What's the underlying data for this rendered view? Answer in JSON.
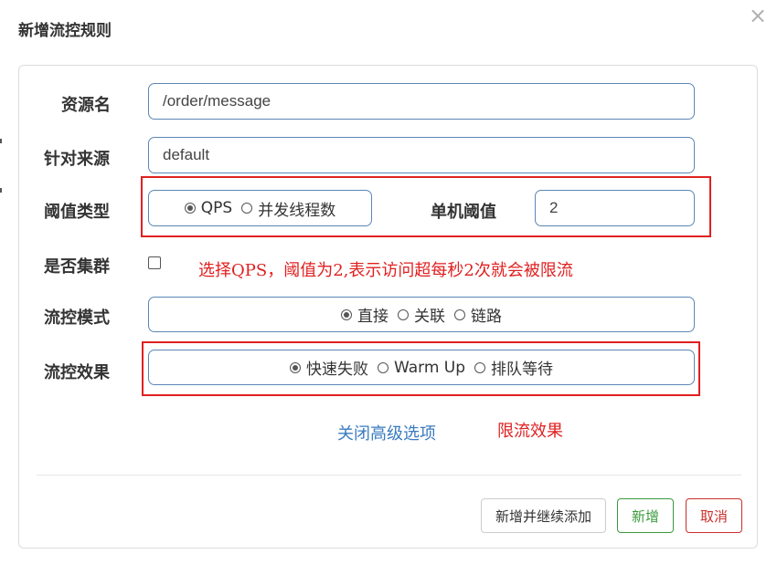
{
  "dialog": {
    "title": "新增流控规则",
    "close_icon": "×"
  },
  "form": {
    "resource": {
      "label": "资源名",
      "value": "/order/message"
    },
    "source": {
      "label": "针对来源",
      "value": "default"
    },
    "threshold_type": {
      "label": "阈值类型",
      "options": [
        {
          "label": "QPS",
          "checked": true
        },
        {
          "label": "并发线程数",
          "checked": false
        }
      ]
    },
    "single_threshold": {
      "label": "单机阈值",
      "value": "2"
    },
    "cluster": {
      "label": "是否集群",
      "checked": false
    },
    "flow_mode": {
      "label": "流控模式",
      "options": [
        {
          "label": "直接",
          "checked": true
        },
        {
          "label": "关联",
          "checked": false
        },
        {
          "label": "链路",
          "checked": false
        }
      ]
    },
    "flow_effect": {
      "label": "流控效果",
      "options": [
        {
          "label": "快速失败",
          "checked": true
        },
        {
          "label": "Warm Up",
          "checked": false
        },
        {
          "label": "排队等待",
          "checked": false
        }
      ]
    },
    "advanced_link": "关闭高级选项"
  },
  "annotations": {
    "threshold_note": "选择QPS，阈值为2,表示访问超每秒2次就会被限流",
    "effect_note": "限流效果",
    "color": "#e02020"
  },
  "buttons": {
    "add_continue": "新增并继续添加",
    "add": "新增",
    "cancel": "取消"
  },
  "colors": {
    "input_border": "#5b87b6",
    "link": "#3a7bbf",
    "add_green": "#3c9a3c",
    "cancel_red": "#c9302c"
  }
}
